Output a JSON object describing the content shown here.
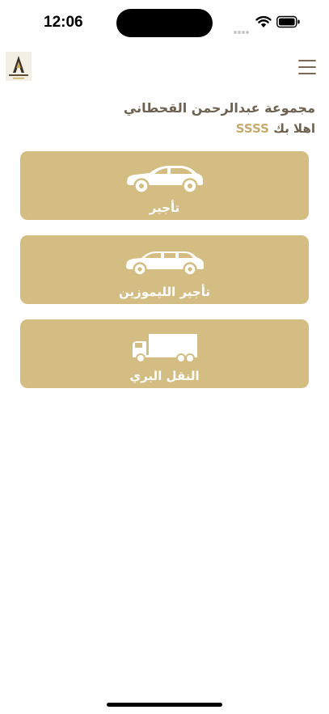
{
  "status_bar": {
    "time": "12:06"
  },
  "header": {
    "logo_icon": "company-logo-icon",
    "menu_icon": "hamburger-menu-icon"
  },
  "greeting": {
    "group_name": "مجموعة عبدالرحمن القحطاني",
    "welcome": "اهلا بك",
    "user_name": "SSSS"
  },
  "services": [
    {
      "label": "تأجير",
      "icon": "car-icon"
    },
    {
      "label": "تأجير الليموزين",
      "icon": "limousine-icon"
    },
    {
      "label": "النقل البري",
      "icon": "truck-icon"
    }
  ],
  "colors": {
    "card_background": "#d3bd82",
    "accent": "#c5ab6d",
    "text": "#6e6150"
  }
}
